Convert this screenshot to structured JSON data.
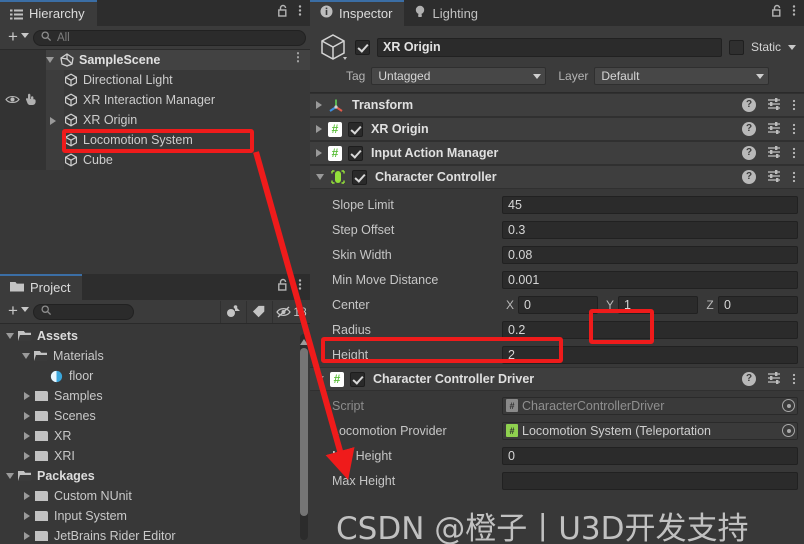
{
  "hierarchy": {
    "tab_label": "Hierarchy",
    "tab_icon": "hierarchy-icon",
    "lock_icon": "lock-open-icon",
    "menu_icon": "kebab-menu-icon",
    "add_label": "+",
    "search_placeholder": "All",
    "search_value": "",
    "scene": {
      "name": "SampleScene"
    },
    "items": [
      {
        "name": "Directional Light",
        "indent": 1,
        "expandable": false,
        "vis": false
      },
      {
        "name": "XR Interaction Manager",
        "indent": 1,
        "expandable": false,
        "vis": true
      },
      {
        "name": "XR Origin",
        "indent": 1,
        "expandable": true,
        "vis": false
      },
      {
        "name": "Locomotion System",
        "indent": 1,
        "expandable": false,
        "vis": false
      },
      {
        "name": "Cube",
        "indent": 1,
        "expandable": false,
        "vis": false
      }
    ]
  },
  "project": {
    "tab_label": "Project",
    "tab_icon": "folder-icon",
    "lock_icon": "lock-open-icon",
    "menu_icon": "kebab-menu-icon",
    "add_label": "+",
    "search_placeholder": "",
    "search_value": "",
    "tool_icons": [
      "asset-filter-icon",
      "label-filter-icon",
      "hidden-packages-icon"
    ],
    "hidden_count": "18",
    "items": [
      {
        "name": "Assets",
        "indent": 0,
        "state": "expanded",
        "kind": "folder",
        "bold": true
      },
      {
        "name": "Materials",
        "indent": 1,
        "state": "expanded",
        "kind": "folder",
        "bold": false
      },
      {
        "name": "floor",
        "indent": 2,
        "state": "leaf",
        "kind": "material",
        "bold": false
      },
      {
        "name": "Samples",
        "indent": 1,
        "state": "collapsed",
        "kind": "folder",
        "bold": false
      },
      {
        "name": "Scenes",
        "indent": 1,
        "state": "collapsed",
        "kind": "folder",
        "bold": false
      },
      {
        "name": "XR",
        "indent": 1,
        "state": "collapsed",
        "kind": "folder",
        "bold": false
      },
      {
        "name": "XRI",
        "indent": 1,
        "state": "collapsed",
        "kind": "folder",
        "bold": false
      },
      {
        "name": "Packages",
        "indent": 0,
        "state": "expanded",
        "kind": "folder",
        "bold": true
      },
      {
        "name": "Custom NUnit",
        "indent": 1,
        "state": "collapsed",
        "kind": "folder",
        "bold": false
      },
      {
        "name": "Input System",
        "indent": 1,
        "state": "collapsed",
        "kind": "folder",
        "bold": false
      },
      {
        "name": "JetBrains Rider Editor",
        "indent": 1,
        "state": "collapsed",
        "kind": "folder",
        "bold": false
      }
    ]
  },
  "inspector": {
    "tabs": [
      {
        "label": "Inspector",
        "icon": "info-icon",
        "active": true
      },
      {
        "label": "Lighting",
        "icon": "light-bulb-icon",
        "active": false
      }
    ],
    "lock_icon": "lock-open-icon",
    "menu_icon": "kebab-menu-icon",
    "object": {
      "icon": "game-object-cube-icon",
      "enabled": true,
      "name": "XR Origin",
      "static_label": "Static",
      "static_checked": false,
      "tag_label": "Tag",
      "tag_value": "Untagged",
      "layer_label": "Layer",
      "layer_value": "Default"
    },
    "components": [
      {
        "name": "Transform",
        "icon": "transform-gizmo-icon",
        "expanded": false,
        "has_checkbox": false,
        "enabled": true
      },
      {
        "name": "XR Origin",
        "icon": "script-cs-icon",
        "expanded": false,
        "has_checkbox": true,
        "enabled": true
      },
      {
        "name": "Input Action Manager",
        "icon": "script-cs-icon",
        "expanded": false,
        "has_checkbox": true,
        "enabled": true
      },
      {
        "name": "Character Controller",
        "icon": "character-controller-capsule-icon",
        "expanded": true,
        "has_checkbox": true,
        "enabled": true,
        "properties": [
          {
            "label": "Slope Limit",
            "type": "number",
            "value": "45"
          },
          {
            "label": "Step Offset",
            "type": "number",
            "value": "0.3"
          },
          {
            "label": "Skin Width",
            "type": "number",
            "value": "0.08"
          },
          {
            "label": "Min Move Distance",
            "type": "number",
            "value": "0.001"
          },
          {
            "label": "Center",
            "type": "vector3",
            "x": "0",
            "y": "1",
            "z": "0",
            "axis_labels": [
              "X",
              "Y",
              "Z"
            ]
          },
          {
            "label": "Radius",
            "type": "number",
            "value": "0.2"
          },
          {
            "label": "Height",
            "type": "number",
            "value": "2"
          }
        ]
      },
      {
        "name": "Character Controller Driver",
        "icon": "script-cs-icon",
        "expanded": true,
        "has_checkbox": true,
        "enabled": true,
        "properties": [
          {
            "label": "Script",
            "type": "object",
            "value": "CharacterControllerDriver",
            "dim": true,
            "chip": "script-cs-chip"
          },
          {
            "label": "Locomotion Provider",
            "type": "object",
            "value": "Locomotion System (Teleportation",
            "dim": false,
            "chip": "script-cs-chip"
          },
          {
            "label": "Min Height",
            "type": "number",
            "value": "0"
          },
          {
            "label": "Max Height",
            "type": "number",
            "value": ""
          }
        ]
      }
    ],
    "row_icons": {
      "help": "help-circle-icon",
      "preset": "preset-sliders-icon",
      "menu": "kebab-menu-icon"
    }
  },
  "annotations": {
    "accent_color": "#ef1b1b",
    "boxes": [
      {
        "name": "locomotion-system-highlight"
      },
      {
        "name": "center-y-highlight"
      },
      {
        "name": "radius-highlight"
      }
    ],
    "arrow": {
      "name": "locomotion-system-to-provider-arrow"
    }
  },
  "watermark": {
    "text": "CSDN @橙子丨U3D开发支持"
  }
}
